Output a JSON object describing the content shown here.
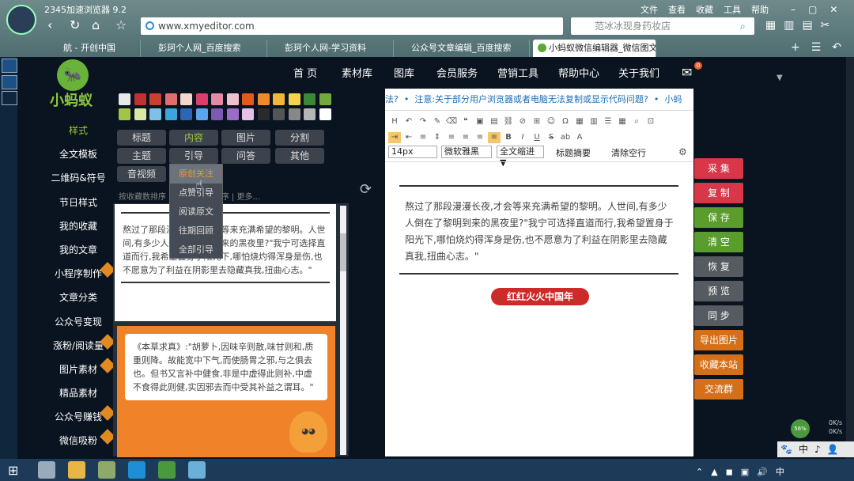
{
  "browser": {
    "title": "2345加速浏览器 9.2",
    "url": "www.xmyeditor.com",
    "search_placeholder": "范冰冰现身药妆店",
    "menus": [
      "文件",
      "查看",
      "收藏",
      "工具",
      "帮助"
    ],
    "tabs": [
      "航 - 开创中国",
      "彭珂个人网_百度搜索",
      "彭珂个人网-学习资料",
      "公众号文章编辑_百度搜索",
      "小蚂蚁微信编辑器_微信图文"
    ]
  },
  "site": {
    "logo_text": "小蚂蚁",
    "nav": [
      "首 页",
      "素材库",
      "图库",
      "会员服务",
      "营销工具",
      "帮助中心",
      "关于我们"
    ],
    "mail_badge": "0",
    "left_nav": [
      {
        "label": "样式",
        "hot": false
      },
      {
        "label": "全文模板",
        "hot": false
      },
      {
        "label": "二维码&符号",
        "hot": false
      },
      {
        "label": "节日样式",
        "hot": false
      },
      {
        "label": "我的收藏",
        "hot": false
      },
      {
        "label": "我的文章",
        "hot": false
      },
      {
        "label": "小程序制作",
        "hot": true
      },
      {
        "label": "文章分类",
        "hot": false
      },
      {
        "label": "公众号变现",
        "hot": false
      },
      {
        "label": "涨粉/阅读量",
        "hot": true
      },
      {
        "label": "图片素材",
        "hot": true
      },
      {
        "label": "精品素材",
        "hot": false
      },
      {
        "label": "公众号赚钱",
        "hot": true
      },
      {
        "label": "微信吸粉",
        "hot": true
      }
    ],
    "colors": [
      "#e8e8e8",
      "#c0312f",
      "#c9402f",
      "#e06e6e",
      "#f5d6cf",
      "#d93f6a",
      "#e58aa3",
      "#f2c0cc",
      "#e15a1e",
      "#ee8a2b",
      "#f2b63c",
      "#f6d34f",
      "#3a8a35",
      "#73a83c",
      "#a3c545",
      "#d6e8a3",
      "#7fc0e6",
      "#3aa6e0",
      "#2c65b5",
      "#5aa5f0",
      "#7c59b3",
      "#9b6bc7",
      "#e6bfe6",
      "#2b2b2b",
      "#555555",
      "#888888",
      "#b5b5b5",
      "#ffffff"
    ],
    "categories": [
      "标题",
      "内容",
      "图片",
      "分割",
      "主题",
      "引导",
      "问答",
      "其他",
      "音视频"
    ],
    "sort_text": "按收藏数排序 | 按总使用数排序 | 更多...",
    "dropdown": [
      "原创关注",
      "点赞引导",
      "阅读原文",
      "往期回顾",
      "全部引导"
    ],
    "card1_text": "熬过了那段漫漫长夜,才会等来充满希望的黎明。人世间,有多少人倒在了黎明到来的黑夜里?\"我宁可选择直道而行,我希望置身于阳光下,哪怕烧灼得浑身是伤,也不愿意为了利益在阴影里去隐藏真我,扭曲心志。\"",
    "card2_text": "《本草求真》:\"胡萝卜,因味辛则散,味甘则和,质重则降。故能宽中下气,而使肠胃之邪,与之俱去也。但书又言补中健食,非是中虚得此则补,中虚不食得此则健,实因邪去而中受其补益之谓耳。\"",
    "notice": "注意:关于部分用户浏览器或者电脑无法复制或显示代码问题?",
    "font_size": "14px",
    "font_family": "微软雅黑",
    "indent": "全文缩进 ▼",
    "summary_btn": "标题摘要",
    "clear_btn": "清除空行",
    "editor_text": "熬过了那段漫漫长夜,才会等来充满希望的黎明。人世间,有多少人倒在了黎明到来的黑夜里?\"我宁可选择直道而行,我希望置身于阳光下,哪怕烧灼得浑身是伤,也不愿意为了利益在阴影里去隐藏真我,扭曲心志。\"",
    "ribbon": "红红火火中国年",
    "actions": [
      {
        "label": "采 集",
        "color": "#d8374a"
      },
      {
        "label": "复 制",
        "color": "#d8374a"
      },
      {
        "label": "保 存",
        "color": "#5a9d2d"
      },
      {
        "label": "清 空",
        "color": "#5a9d2d"
      },
      {
        "label": "恢 复",
        "color": "#555b60"
      },
      {
        "label": "预 览",
        "color": "#555b60"
      },
      {
        "label": "同 步",
        "color": "#555b60"
      },
      {
        "label": "导出图片",
        "color": "#d57019"
      },
      {
        "label": "收藏本站",
        "color": "#d57019"
      },
      {
        "label": "交流群",
        "color": "#d57019"
      }
    ]
  },
  "tray": {
    "pct": "56%",
    "up": "0K/s",
    "down": "0K/s",
    "ime": "中",
    "time": "",
    "icons": "中"
  }
}
